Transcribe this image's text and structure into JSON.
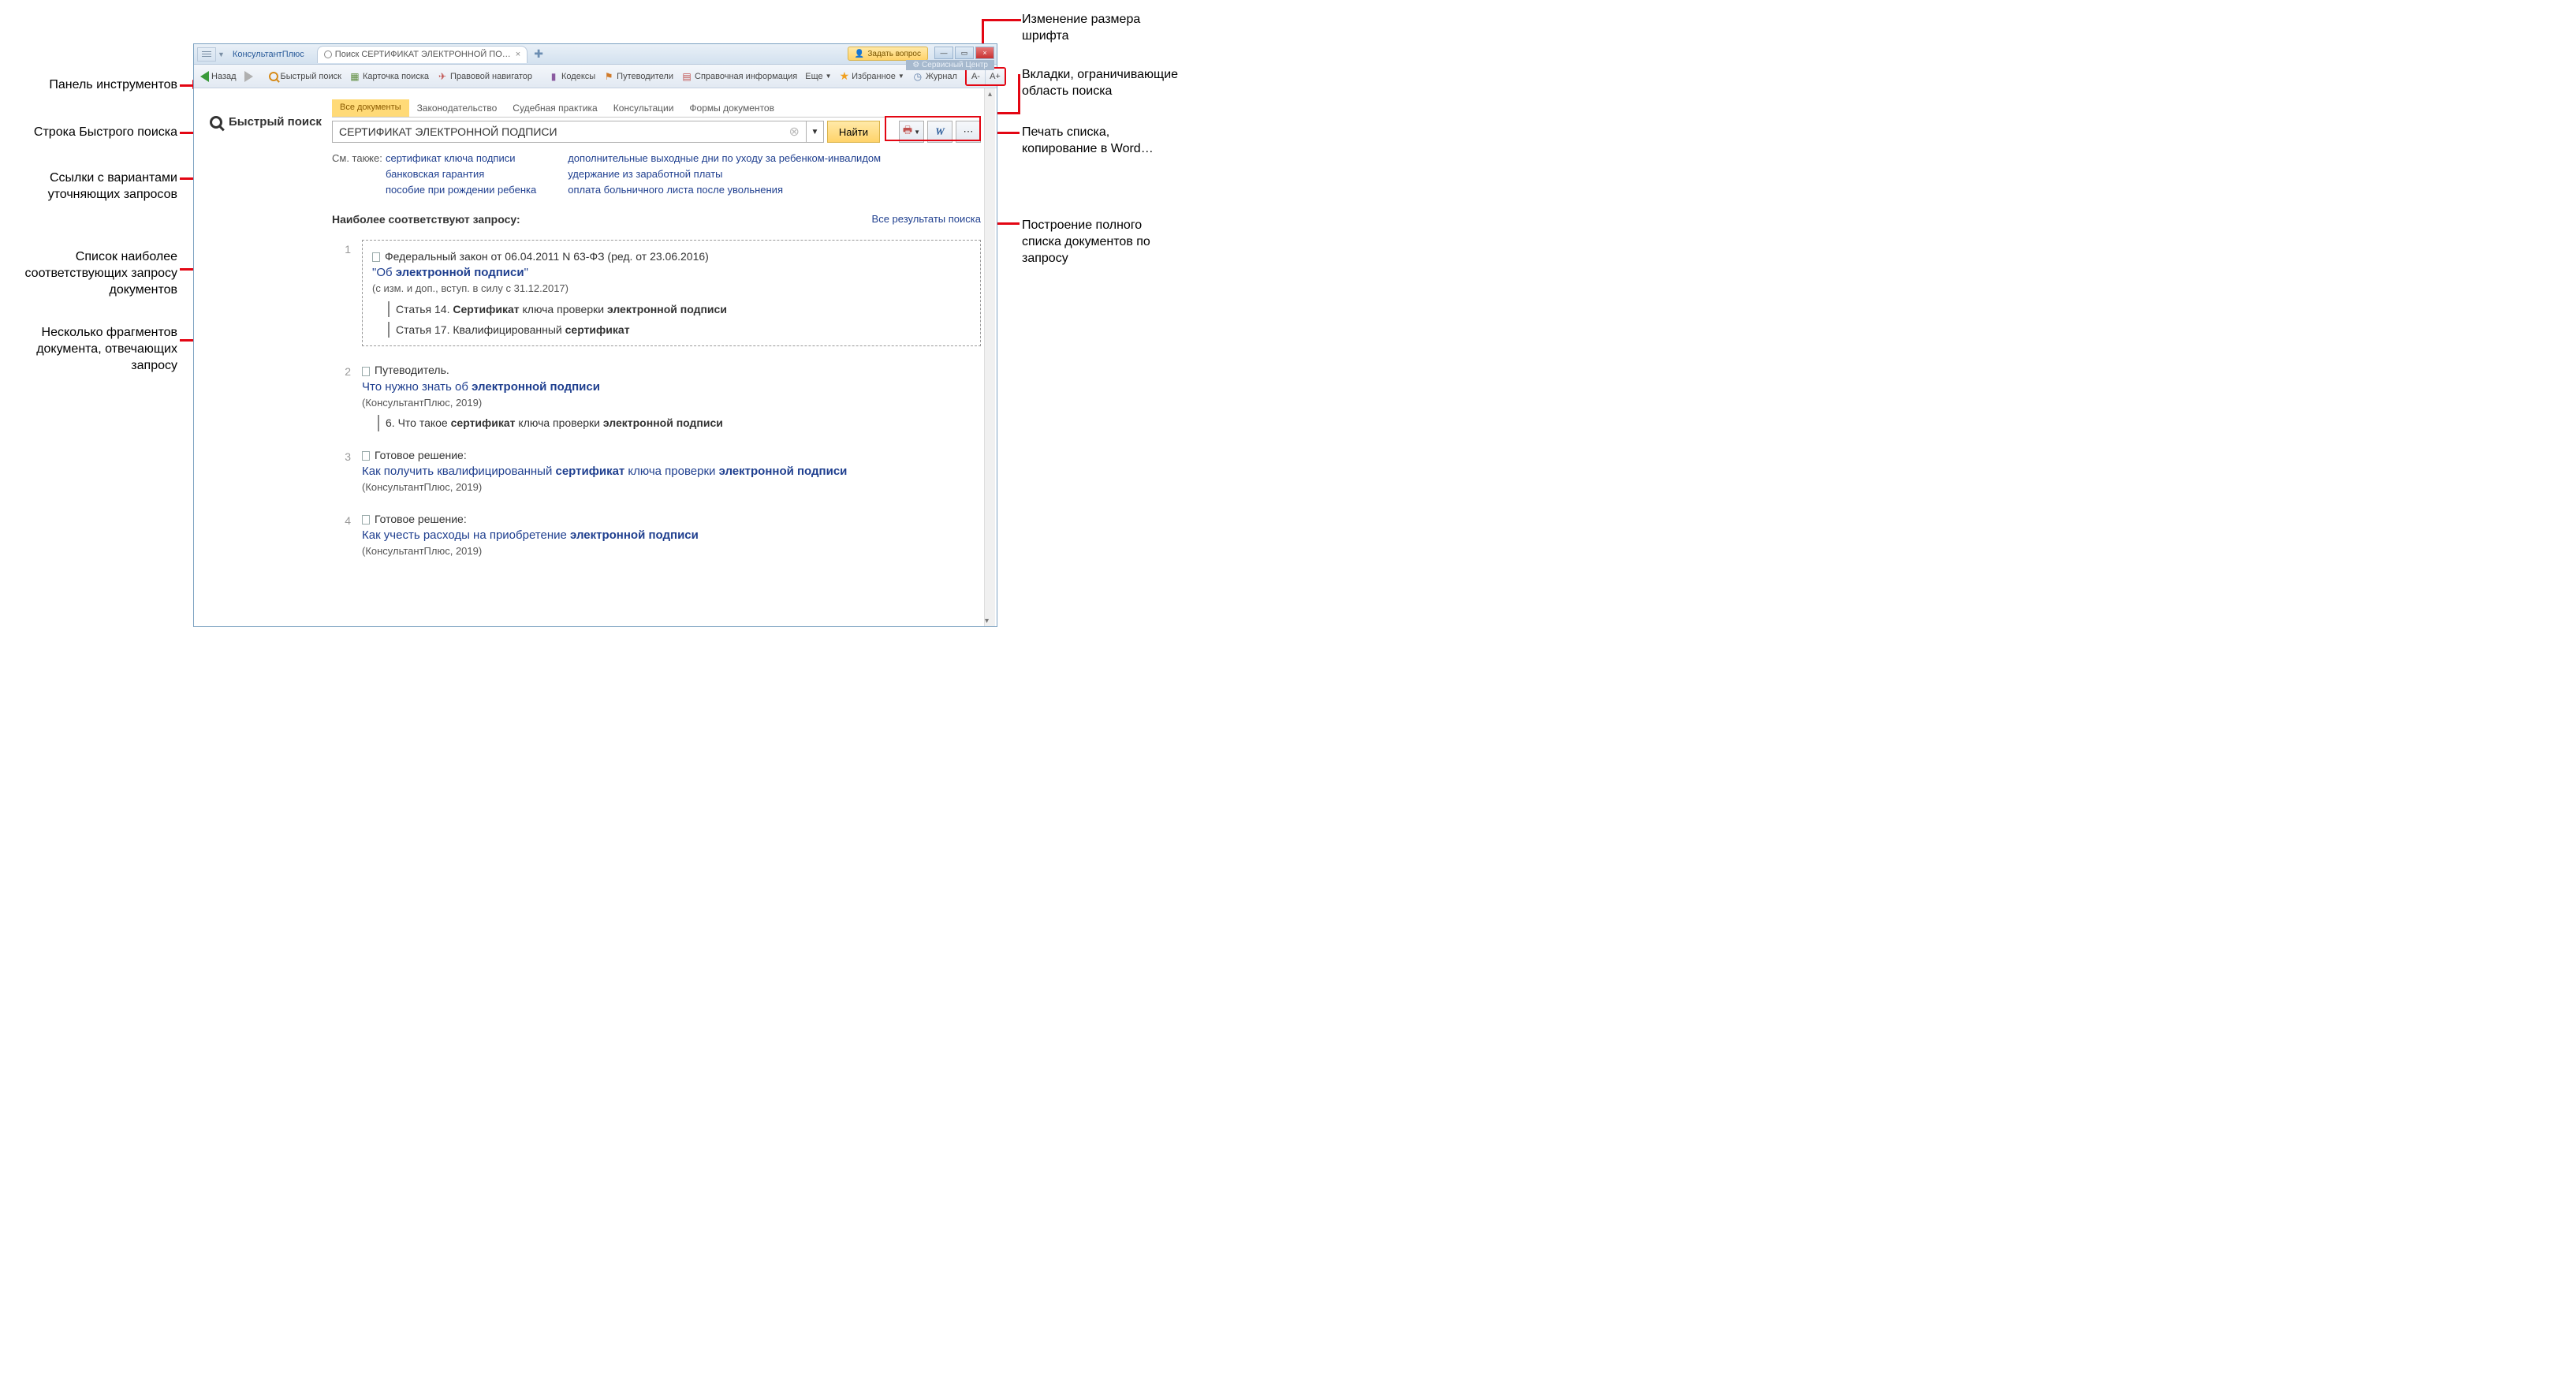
{
  "annotations": {
    "toolbar": "Панель инструментов",
    "quick_search_row": "Строка Быстрого поиска",
    "refine_links": "Ссылки с вариантами уточняющих запросов",
    "top_list": "Список наиболее соответствующих запросу документов",
    "fragments": "Несколько фрагментов документа, отвечающих запросу",
    "font_size": "Изменение размера шрифта",
    "scope_tabs": "Вкладки, ограничивающие область поиска",
    "actions": "Печать списка, копирование в Word…",
    "full_list": "Построение полного списка документов по запросу"
  },
  "titlebar": {
    "app_tab": "КонсультантПлюс",
    "open_tab": "Поиск СЕРТИФИКАТ ЭЛЕКТРОННОЙ ПО…",
    "ask": "Задать вопрос",
    "service": "Сервисный Центр"
  },
  "toolbar": {
    "back": "Назад",
    "quick_search": "Быстрый поиск",
    "card": "Карточка поиска",
    "navigator": "Правовой навигатор",
    "codex": "Кодексы",
    "guides": "Путеводители",
    "ref": "Справочная информация",
    "more": "Еще",
    "fav": "Избранное",
    "journal": "Журнал",
    "font_minus": "A-",
    "font_plus": "A+"
  },
  "search": {
    "label": "Быстрый поиск",
    "input_value": "СЕРТИФИКАТ ЭЛЕКТРОННОЙ ПОДПИСИ",
    "find": "Найти",
    "scope": {
      "all": "Все документы",
      "law": "Законодательство",
      "court": "Судебная практика",
      "consult": "Консультации",
      "forms": "Формы документов"
    }
  },
  "also": {
    "label": "См. также:",
    "col1": [
      "сертификат ключа подписи",
      "банковская гарантия",
      "пособие при рождении ребенка"
    ],
    "col2": [
      "дополнительные выходные дни по уходу за ребенком-инвалидом",
      "удержание из заработной платы",
      "оплата больничного листа после увольнения"
    ]
  },
  "results": {
    "heading": "Наиболее соответствуют запросу:",
    "all_link": "Все результаты поиска",
    "items": [
      {
        "num": "1",
        "line1": "Федеральный закон от 06.04.2011 N 63-ФЗ (ред. от 23.06.2016)",
        "title_pre": "\"Об ",
        "title_b": "электронной подписи",
        "title_post": "\"",
        "meta": "(с изм. и доп., вступ. в силу с 31.12.2017)",
        "frag1_pre": "Статья 14. ",
        "frag1_b1": "Сертификат",
        "frag1_mid": " ключа проверки ",
        "frag1_b2": "электронной подписи",
        "frag2_pre": "Статья 17. Квалифицированный ",
        "frag2_b": "сертификат"
      },
      {
        "num": "2",
        "line1": "Путеводитель.",
        "title_pre": "Что нужно знать об ",
        "title_b": "электронной подписи",
        "meta": "(КонсультантПлюс, 2019)",
        "frag1_pre": "6. Что такое ",
        "frag1_b1": "сертификат",
        "frag1_mid": " ключа проверки ",
        "frag1_b2": "электронной подписи"
      },
      {
        "num": "3",
        "line1": "Готовое решение:",
        "title_pre": "Как получить квалифицированный ",
        "title_b1": "сертификат",
        "title_mid": " ключа проверки ",
        "title_b2": "электронной подписи",
        "meta": "(КонсультантПлюс, 2019)"
      },
      {
        "num": "4",
        "line1": "Готовое решение:",
        "title_pre": "Как учесть расходы на приобретение ",
        "title_b": "электронной подписи",
        "meta": "(КонсультантПлюс, 2019)"
      }
    ]
  }
}
